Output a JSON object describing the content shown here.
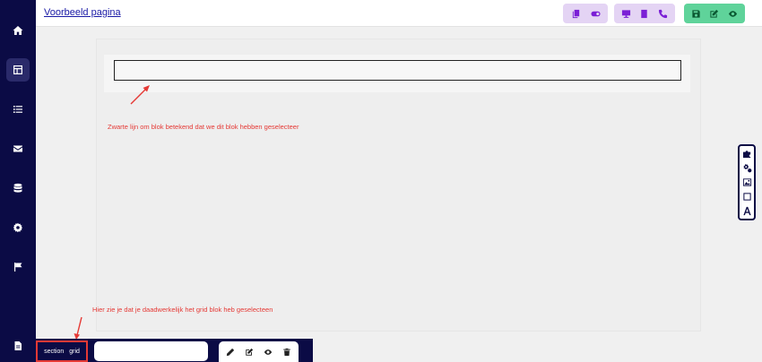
{
  "header": {
    "page_title": "Voorbeeld pagina"
  },
  "sidebar": {
    "items": [
      {
        "icon": "home-icon"
      },
      {
        "icon": "layout-icon",
        "active": true
      },
      {
        "icon": "list-icon"
      },
      {
        "icon": "envelope-icon"
      },
      {
        "icon": "database-icon"
      },
      {
        "icon": "gear-icon"
      },
      {
        "icon": "flag-icon"
      },
      {
        "icon": "document-icon"
      }
    ]
  },
  "toolbar": {
    "groups": [
      {
        "color": "#e4d4f4",
        "icons": [
          "copy-icon",
          "toggle-icon"
        ]
      },
      {
        "color": "#e4d4f4",
        "icons": [
          "desktop-icon",
          "tablet-icon",
          "phone-icon"
        ]
      },
      {
        "color": "#5fd39a",
        "icons": [
          "save-icon",
          "edit-icon",
          "eye-icon"
        ]
      }
    ]
  },
  "annotations": {
    "block_note": "Zwarte lijn om blok betekend dat we dit blok hebben geselecteer",
    "crumb_note": "Hier zie je dat je daadwerkelijk het grid blok heb geselecteen"
  },
  "toolbox": {
    "icons": [
      "puzzle-icon",
      "gears-icon",
      "image-icon",
      "square-icon",
      "text-icon"
    ]
  },
  "bottombar": {
    "breadcrumb": [
      "section",
      "grid"
    ],
    "name_input": {
      "value": "",
      "placeholder": ""
    },
    "actions": [
      "pencil-icon",
      "edit-icon",
      "eye-icon",
      "trash-icon"
    ]
  },
  "colors": {
    "sidebar": "#0b0b45",
    "annotation": "#e53935",
    "link": "#1a1aa6"
  }
}
